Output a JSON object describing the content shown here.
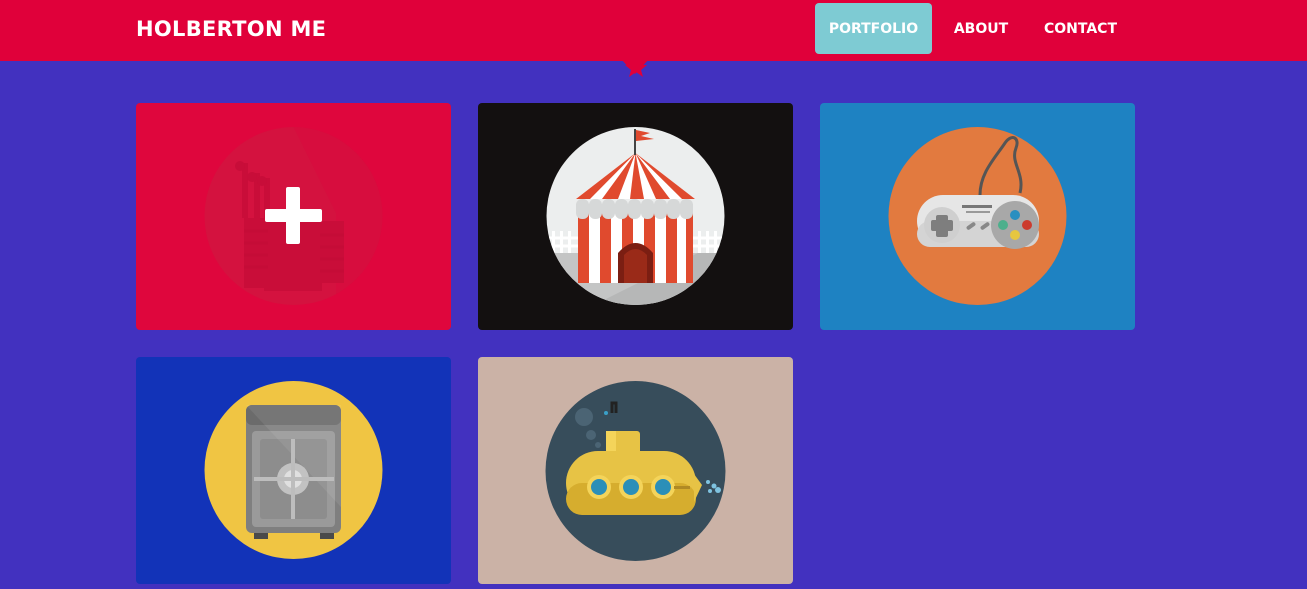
{
  "site": {
    "brand": "HOLBERTON ME"
  },
  "nav": {
    "items": [
      {
        "label": "PORTFOLIO",
        "active": true
      },
      {
        "label": "ABOUT",
        "active": false
      },
      {
        "label": "CONTACT",
        "active": false
      }
    ]
  },
  "colors": {
    "page_background": "#4231bf",
    "header": "#e0003a",
    "nav_active": "#7ecbd3",
    "card_fort_bg": "#df063d",
    "card_circus_bg": "#131010",
    "card_gamepad_bg": "#1e82c2",
    "card_safe_bg": "#1233b8",
    "card_submarine_bg": "#cbb2a6"
  },
  "portfolio": {
    "items": [
      {
        "icon": "fort-icon",
        "hover_icon": "plus-icon",
        "hovered": true
      },
      {
        "icon": "circus-tent-icon",
        "hovered": false
      },
      {
        "icon": "game-controller-icon",
        "hovered": false
      },
      {
        "icon": "safe-icon",
        "hovered": false
      },
      {
        "icon": "submarine-icon",
        "hovered": false
      }
    ]
  }
}
